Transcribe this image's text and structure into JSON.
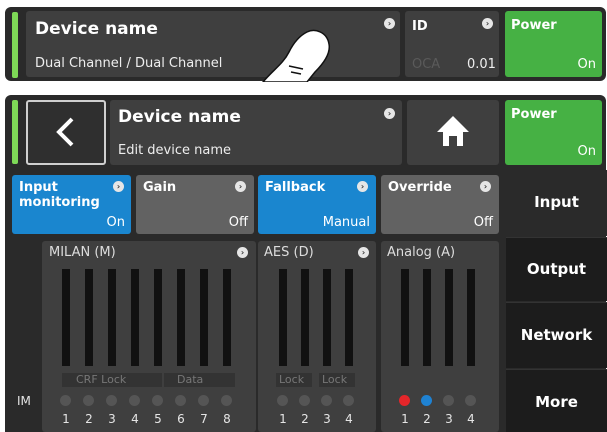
{
  "top_bar": {
    "device_title": "Device name",
    "device_subtitle": "Dual Channel / Dual Channel",
    "id_label": "ID",
    "id_protocol": "OCA",
    "id_value": "0.01",
    "power_label": "Power",
    "power_state": "On"
  },
  "header": {
    "device_title": "Device name",
    "device_subtitle": "Edit device name",
    "power_label": "Power",
    "power_state": "On"
  },
  "tiles": [
    {
      "label": "Input monitoring",
      "state": "On"
    },
    {
      "label": "Gain",
      "state": "Off"
    },
    {
      "label": "Fallback",
      "state": "Manual"
    },
    {
      "label": "Override",
      "state": "Off"
    }
  ],
  "side_nav": [
    "Input",
    "Output",
    "Network",
    "More"
  ],
  "meters": {
    "side_label": "IM",
    "groups": [
      {
        "title": "MILAN (M)",
        "sublabels": [
          "CRF Lock",
          "Data"
        ],
        "channels": [
          "1",
          "2",
          "3",
          "4",
          "5",
          "6",
          "7",
          "8"
        ]
      },
      {
        "title": "AES (D)",
        "sublabels": [
          "Lock",
          "Lock"
        ],
        "channels": [
          "1",
          "2",
          "3",
          "4"
        ]
      },
      {
        "title": "Analog (A)",
        "sublabels": [],
        "channels": [
          "1",
          "2",
          "3",
          "4"
        ]
      }
    ],
    "analog_dot_colors": [
      "#e4262a",
      "#1f82d2",
      "#555555",
      "#555555"
    ]
  },
  "colors": {
    "accent_green": "#46b144",
    "accent_blue": "#1a86cf",
    "active_bar": "#7ed957"
  }
}
